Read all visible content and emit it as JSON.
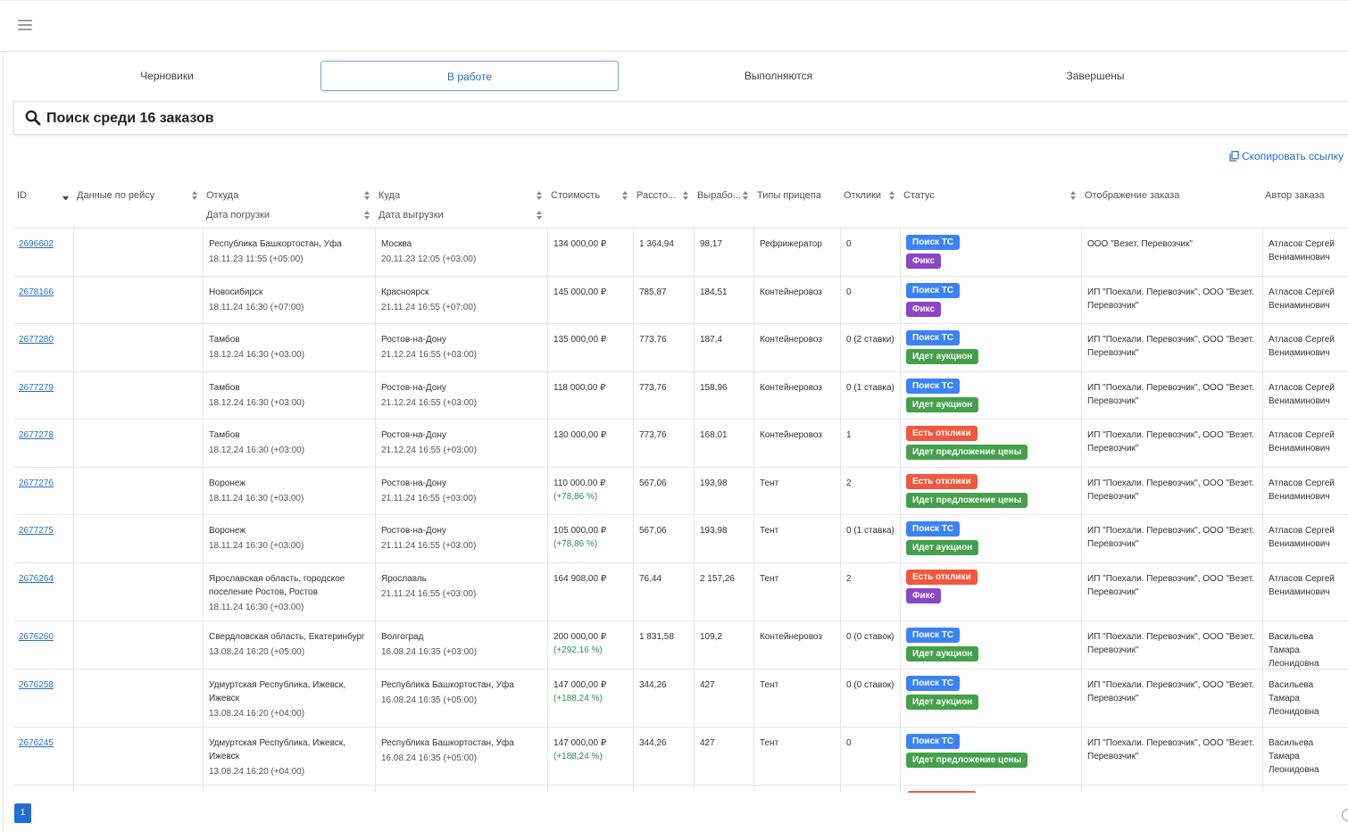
{
  "tabs": [
    {
      "label": "Черновики"
    },
    {
      "label": "В работе"
    },
    {
      "label": "Выполняются"
    },
    {
      "label": "Завершены"
    }
  ],
  "active_tab": "В работе",
  "search": {
    "placeholder": "Поиск среди 16 заказов",
    "value": ""
  },
  "copy_link": "Скопировать ссылку",
  "columns": {
    "id": "ID",
    "trip_data": "Данные по рейсу",
    "from": "Откуда",
    "load_date": "Дата погрузки",
    "to": "Куда",
    "unload_date": "Дата выгрузки",
    "cost": "Стоимость",
    "distance": "Рассто...",
    "output": "Вырабо...",
    "trailer": "Типы прицепа",
    "responses": "Отклики",
    "status": "Статус",
    "display": "Отображение заказа",
    "author": "Автор заказа"
  },
  "rows": [
    {
      "id": "2696602",
      "from": "Республика Башкортостан, Уфа",
      "load": "18.11.23 11:55 (+05:00)",
      "to": "Москва",
      "unload": "20.11.23 12:05 (+03:00)",
      "cost": "134 000,00 ₽",
      "pct": "",
      "dist": "1 364,94",
      "out": "98,17",
      "trailer": "Рефрижератор",
      "resp": "0",
      "badges": [
        {
          "text": "Поиск ТС",
          "color": "blue"
        },
        {
          "text": "Фикс",
          "color": "purple"
        }
      ],
      "display": "ООО \"Везет. Перевозчик\"",
      "author": "Атласов Сергей Вениаминович"
    },
    {
      "id": "2678166",
      "from": "Новосибирск",
      "load": "18.11.24 16:30 (+07:00)",
      "to": "Красноярск",
      "unload": "21.11.24 16:55 (+07:00)",
      "cost": "145 000,00 ₽",
      "pct": "",
      "dist": "785,87",
      "out": "184,51",
      "trailer": "Контейнеровоз",
      "resp": "0",
      "badges": [
        {
          "text": "Поиск ТС",
          "color": "blue"
        },
        {
          "text": "Фикс",
          "color": "purple"
        }
      ],
      "display": "ИП \"Поехали. Перевозчик\", ООО \"Везет. Перевозчик\"",
      "author": "Атласов Сергей Вениаминович"
    },
    {
      "id": "2677280",
      "from": "Тамбов",
      "load": "18.12.24 16:30 (+03:00)",
      "to": "Ростов-на-Дону",
      "unload": "21.12.24 16:55 (+03:00)",
      "cost": "135 000,00 ₽",
      "pct": "",
      "dist": "773,76",
      "out": "187,4",
      "trailer": "Контейнеровоз",
      "resp": "0 (2 ставки)",
      "badges": [
        {
          "text": "Поиск ТС",
          "color": "blue"
        },
        {
          "text": "Идет аукцион",
          "color": "green"
        }
      ],
      "display": "ИП \"Поехали. Перевозчик\", ООО \"Везет. Перевозчик\"",
      "author": "Атласов Сергей Вениаминович"
    },
    {
      "id": "2677279",
      "from": "Тамбов",
      "load": "18.12.24 16:30 (+03:00)",
      "to": "Ростов-на-Дону",
      "unload": "21.12.24 16:55 (+03:00)",
      "cost": "118 000,00 ₽",
      "pct": "",
      "dist": "773,76",
      "out": "158,96",
      "trailer": "Контейнеровоз",
      "resp": "0 (1 ставка)",
      "badges": [
        {
          "text": "Поиск ТС",
          "color": "blue"
        },
        {
          "text": "Идет аукцион",
          "color": "green"
        }
      ],
      "display": "ИП \"Поехали. Перевозчик\", ООО \"Везет. Перевозчик\"",
      "author": "Атласов Сергей Вениаминович"
    },
    {
      "id": "2677278",
      "from": "Тамбов",
      "load": "18.12.24 16:30 (+03:00)",
      "to": "Ростов-на-Дону",
      "unload": "21.12.24 16:55 (+03:00)",
      "cost": "130 000,00 ₽",
      "pct": "",
      "dist": "773,76",
      "out": "168,01",
      "trailer": "Контейнеровоз",
      "resp": "1",
      "badges": [
        {
          "text": "Есть отклики",
          "color": "red"
        },
        {
          "text": "Идет предложение цены",
          "color": "green"
        }
      ],
      "display": "ИП \"Поехали. Перевозчик\", ООО \"Везет. Перевозчик\"",
      "author": "Атласов Сергей Вениаминович"
    },
    {
      "id": "2677276",
      "from": "Воронеж",
      "load": "18.11.24 16:30 (+03:00)",
      "to": "Ростов-на-Дону",
      "unload": "21.11.24 16:55 (+03:00)",
      "cost": "110 000,00 ₽",
      "pct": "(+78,86 %)",
      "dist": "567,06",
      "out": "193,98",
      "trailer": "Тент",
      "resp": "2",
      "badges": [
        {
          "text": "Есть отклики",
          "color": "red"
        },
        {
          "text": "Идет предложение цены",
          "color": "green"
        }
      ],
      "display": "ИП \"Поехали. Перевозчик\", ООО \"Везет. Перевозчик\"",
      "author": "Атласов Сергей Вениаминович"
    },
    {
      "id": "2677275",
      "from": "Воронеж",
      "load": "18.11.24 16:30 (+03:00)",
      "to": "Ростов-на-Дону",
      "unload": "21.11.24 16:55 (+03:00)",
      "cost": "105 000,00 ₽",
      "pct": "(+78,86 %)",
      "dist": "567,06",
      "out": "193,98",
      "trailer": "Тент",
      "resp": "0 (1 ставка)",
      "badges": [
        {
          "text": "Поиск ТС",
          "color": "blue"
        },
        {
          "text": "Идет аукцион",
          "color": "green"
        }
      ],
      "display": "ИП \"Поехали. Перевозчик\", ООО \"Везет. Перевозчик\"",
      "author": "Атласов Сергей Вениаминович"
    },
    {
      "id": "2676264",
      "from": "Ярославская область, городское поселение Ростов, Ростов",
      "load": "18.11.24 16:30 (+03:00)",
      "to": "Ярославль",
      "unload": "21.11.24 16:55 (+03:00)",
      "cost": "164 908,00 ₽",
      "pct": "",
      "dist": "76,44",
      "out": "2 157,26",
      "trailer": "Тент",
      "resp": "2",
      "badges": [
        {
          "text": "Есть отклики",
          "color": "red"
        },
        {
          "text": "Фикс",
          "color": "purple"
        }
      ],
      "display": "ИП \"Поехали. Перевозчик\", ООО \"Везет. Перевозчик\"",
      "author": "Атласов Сергей Вениаминович"
    },
    {
      "id": "2676260",
      "from": "Свердловская область, Екатеринбург",
      "load": "13.08.24 16:20 (+05:00)",
      "to": "Волгоград",
      "unload": "16.08.24 16:35 (+03:00)",
      "cost": "200 000,00 ₽",
      "pct": "(+292,16 %)",
      "dist": "1 831,58",
      "out": "109,2",
      "trailer": "Контейнеровоз",
      "resp": "0 (0 ставок)",
      "badges": [
        {
          "text": "Поиск ТС",
          "color": "blue"
        },
        {
          "text": "Идет аукцион",
          "color": "green"
        }
      ],
      "display": "ИП \"Поехали. Перевозчик\", ООО \"Везет. Перевозчик\"",
      "author": "Васильева Тамара Леонидовна"
    },
    {
      "id": "2676258",
      "from": "Удмуртская Республика, Ижевск, Ижевск",
      "load": "13.08.24 16:20 (+04:00)",
      "to": "Республика Башкортостан, Уфа",
      "unload": "16.08.24 16:35 (+05:00)",
      "cost": "147 000,00 ₽",
      "pct": "(+188,24 %)",
      "dist": "344,26",
      "out": "427",
      "trailer": "Тент",
      "resp": "0 (0 ставок)",
      "badges": [
        {
          "text": "Поиск ТС",
          "color": "blue"
        },
        {
          "text": "Идет аукцион",
          "color": "green"
        }
      ],
      "display": "ИП \"Поехали. Перевозчик\", ООО \"Везет. Перевозчик\"",
      "author": "Васильева Тамара Леонидовна"
    },
    {
      "id": "2676245",
      "from": "Удмуртская Республика, Ижевск, Ижевск",
      "load": "13.08.24 16:20 (+04:00)",
      "to": "Республика Башкортостан, Уфа",
      "unload": "16.08.24 16:35 (+05:00)",
      "cost": "147 000,00 ₽",
      "pct": "(+188,24 %)",
      "dist": "344,26",
      "out": "427",
      "trailer": "Тент",
      "resp": "0",
      "badges": [
        {
          "text": "Поиск ТС",
          "color": "blue"
        },
        {
          "text": "Идет предложение цены",
          "color": "green"
        }
      ],
      "display": "ИП \"Поехали. Перевозчик\", ООО \"Везет. Перевозчик\"",
      "author": "Васильева Тамара Леонидовна"
    }
  ],
  "pagination": {
    "current": "1"
  },
  "colors": {
    "accent": "#1f6fd1",
    "blue": "#3b82f6",
    "purple": "#8b45c5",
    "green": "#44a04a",
    "red": "#f2573e"
  }
}
